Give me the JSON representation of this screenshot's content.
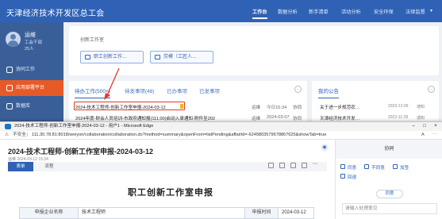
{
  "app": {
    "title": "天津经济技术开发区总工会",
    "nav": [
      "工作台",
      "数据分析",
      "新手清单",
      "活动分析",
      "安全环保",
      "法律监督"
    ],
    "nav_more": "▾"
  },
  "user": {
    "name": "运维",
    "role": "工会干部",
    "count": "25人"
  },
  "sidebar": {
    "items": [
      {
        "label": "协同工作",
        "icon": "collab-icon"
      },
      {
        "label": "应用部署平台",
        "icon": "app-icon"
      },
      {
        "label": "数据库",
        "icon": "database-icon"
      }
    ]
  },
  "quick": {
    "label": "创新工作室",
    "chips": [
      "职工创新工作…",
      "劳模（工匠人…"
    ]
  },
  "todo": {
    "tabs": [
      "待办工作(500+)",
      "待发事项(48)",
      "已办事项",
      "已发事项"
    ],
    "rows": [
      {
        "title": "2024-技术工程师-创新工作室申报-2024-03-12",
        "user": "运维",
        "date": "今日15:34",
        "type": "协同"
      },
      {
        "title": "2024年度-财会人员培训-市政府通知报(111.00)启动入录通知-附件至202",
        "user": "运维",
        "date": "2024-03-07",
        "type": "协同"
      }
    ]
  },
  "notice": {
    "title": "我的公告",
    "rows": [
      {
        "title": "关于进一步规范农…",
        "date": "2023-12-06",
        "source": "通知"
      },
      {
        "title": "天津经济技术开发…",
        "date": "2023-11-28",
        "source": "通知"
      }
    ]
  },
  "edge": {
    "window_title": "2024-技术工程师-创新工作室申报-2024-03-12 - 用户1 - Microsoft Edge",
    "insecure": "不安全",
    "url": "111.30.78.81:8018/seeyon/collaboration/collaboration.do?method=summary&openFrom=listPending&affairId=-6245803579678867625&showTab=true"
  },
  "doc": {
    "title": "2024-技术工程师-创新工作室申报-2024-03-12",
    "meta": "运维  2024-03-12 15:34",
    "tabs": [
      "表单",
      "流程"
    ],
    "form_title": "职工创新工作室申报",
    "fields": [
      {
        "label": "申报企业名称",
        "value": "技术工程师"
      },
      {
        "label": "申报时间",
        "value": "2024-03-12"
      }
    ]
  },
  "handle": {
    "title": "协同",
    "actions": [
      "同意",
      "不同意",
      "加签",
      "回退"
    ],
    "submit": "同意",
    "placeholder": "请输入处理意见"
  },
  "colors": {
    "primary": "#2f62b5",
    "sidebar": "#3a5f98",
    "accent": "#e65a28",
    "highlight": "#e23b2b"
  }
}
